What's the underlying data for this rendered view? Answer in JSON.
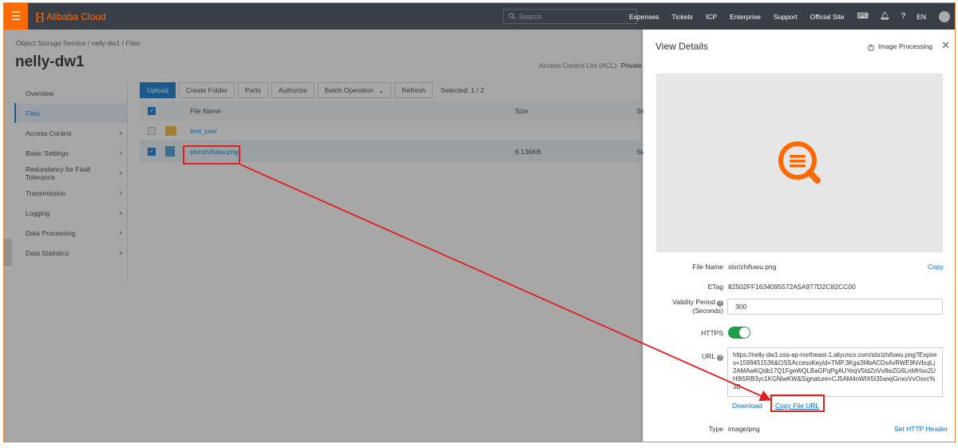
{
  "topbar": {
    "logo_text": "Alibaba Cloud",
    "search_placeholder": "Search",
    "nav": [
      "Expenses",
      "Tickets",
      "ICP",
      "Enterprise",
      "Support",
      "Official Site"
    ],
    "lang": "EN",
    "colors": {
      "bar": "#3a3f47",
      "brand": "#ff6a00"
    }
  },
  "breadcrumb": "Object Storage Service  /  nelly-dw1  /  Files",
  "bucket": {
    "name": "nelly-dw1",
    "acl_label": "Access Control List (ACL)",
    "acl_value": "Private"
  },
  "sidebar": {
    "items": [
      {
        "label": "Overview",
        "chevron": false
      },
      {
        "label": "Files",
        "chevron": false,
        "active": true
      },
      {
        "label": "Access Control",
        "chevron": true
      },
      {
        "label": "Basic Settings",
        "chevron": true
      },
      {
        "label": "Redundancy for Fault Tolerance",
        "chevron": true
      },
      {
        "label": "Transmission",
        "chevron": true
      },
      {
        "label": "Logging",
        "chevron": true
      },
      {
        "label": "Data Processing",
        "chevron": true
      },
      {
        "label": "Data Statistics",
        "chevron": true
      }
    ]
  },
  "toolbar": {
    "upload": "Upload",
    "create_folder": "Create Folder",
    "parts": "Parts",
    "authorize": "Authorize",
    "batch": "Batch Operation",
    "refresh": "Refresh",
    "selected": "Selected: 1 / 2"
  },
  "table": {
    "headers": {
      "name": "File Name",
      "size": "Size",
      "storage": "Sto"
    },
    "rows": [
      {
        "name": "test_csv/",
        "size": "",
        "storage": "",
        "type": "folder",
        "checked": false
      },
      {
        "name": "slsrizhifuwu.png",
        "size": "6.136KB",
        "storage": "Sta",
        "type": "image",
        "checked": true
      }
    ]
  },
  "panel": {
    "title": "View Details",
    "image_processing": "Image Processing",
    "file_name_label": "File Name",
    "file_name": "slsrizhifuwu.png",
    "copy": "Copy",
    "etag_label": "ETag",
    "etag": "82502FF1634095572A5A977D2C82CC00",
    "validity_label_1": "Validity Period",
    "validity_label_2": "(Seconds)",
    "validity_value": "300",
    "https_label": "HTTPS",
    "https_on": true,
    "url_label": "URL",
    "url": "https://nelly-dw1.oss-ap-northeast-1.aliyuncs.com/slsrizhifuwu.png?Expires=1599451536&OSSAccessKeyId=TMP.3Kga3f4bACDxAvRWE9NVbujLj2AMAwKQdb17Q1FgeWQLBaGPqPgAUYeqV5tdZoVv8wZG6LnMHxo2UH9t5RB3yc1KGNiwKW&Signature=CJ5AM4nWIX5t35wwjGnxoVvOsvc%3D",
    "download": "Download",
    "copy_url": "Copy File URL",
    "type_label": "Type",
    "type_value": "image/png",
    "set_header": "Set HTTP Header"
  },
  "annotation": {
    "color": "#e02020"
  }
}
